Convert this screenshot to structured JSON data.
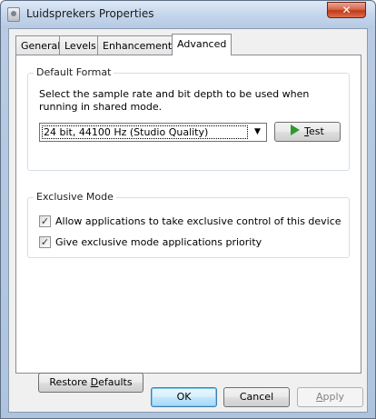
{
  "window": {
    "title": "Luidsprekers Properties",
    "close_label": "✕"
  },
  "tabs": [
    {
      "label": "General",
      "active": false
    },
    {
      "label": "Levels",
      "active": false
    },
    {
      "label": "Enhancements",
      "active": false
    },
    {
      "label": "Advanced",
      "active": true
    }
  ],
  "default_format": {
    "title": "Default Format",
    "description": "Select the sample rate and bit depth to be used when running in shared mode.",
    "selected_format": "24 bit, 44100 Hz (Studio Quality)",
    "test_label_accel": "T",
    "test_label_rest": "est"
  },
  "exclusive_mode": {
    "title": "Exclusive Mode",
    "options": [
      {
        "label": "Allow applications to take exclusive control of this device",
        "checked": true
      },
      {
        "label": "Give exclusive mode applications priority",
        "checked": true
      }
    ]
  },
  "restore_defaults": {
    "label_pre": "Restore ",
    "label_accel": "D",
    "label_post": "efaults"
  },
  "dialog_buttons": {
    "ok": "OK",
    "cancel": "Cancel",
    "apply_accel": "A",
    "apply_rest": "pply"
  },
  "icons": {
    "app": "speaker-properties-icon",
    "play": "play-icon",
    "close": "close-icon"
  },
  "colors": {
    "play_green": "#2e9a2e",
    "close_red": "#c2391a"
  }
}
